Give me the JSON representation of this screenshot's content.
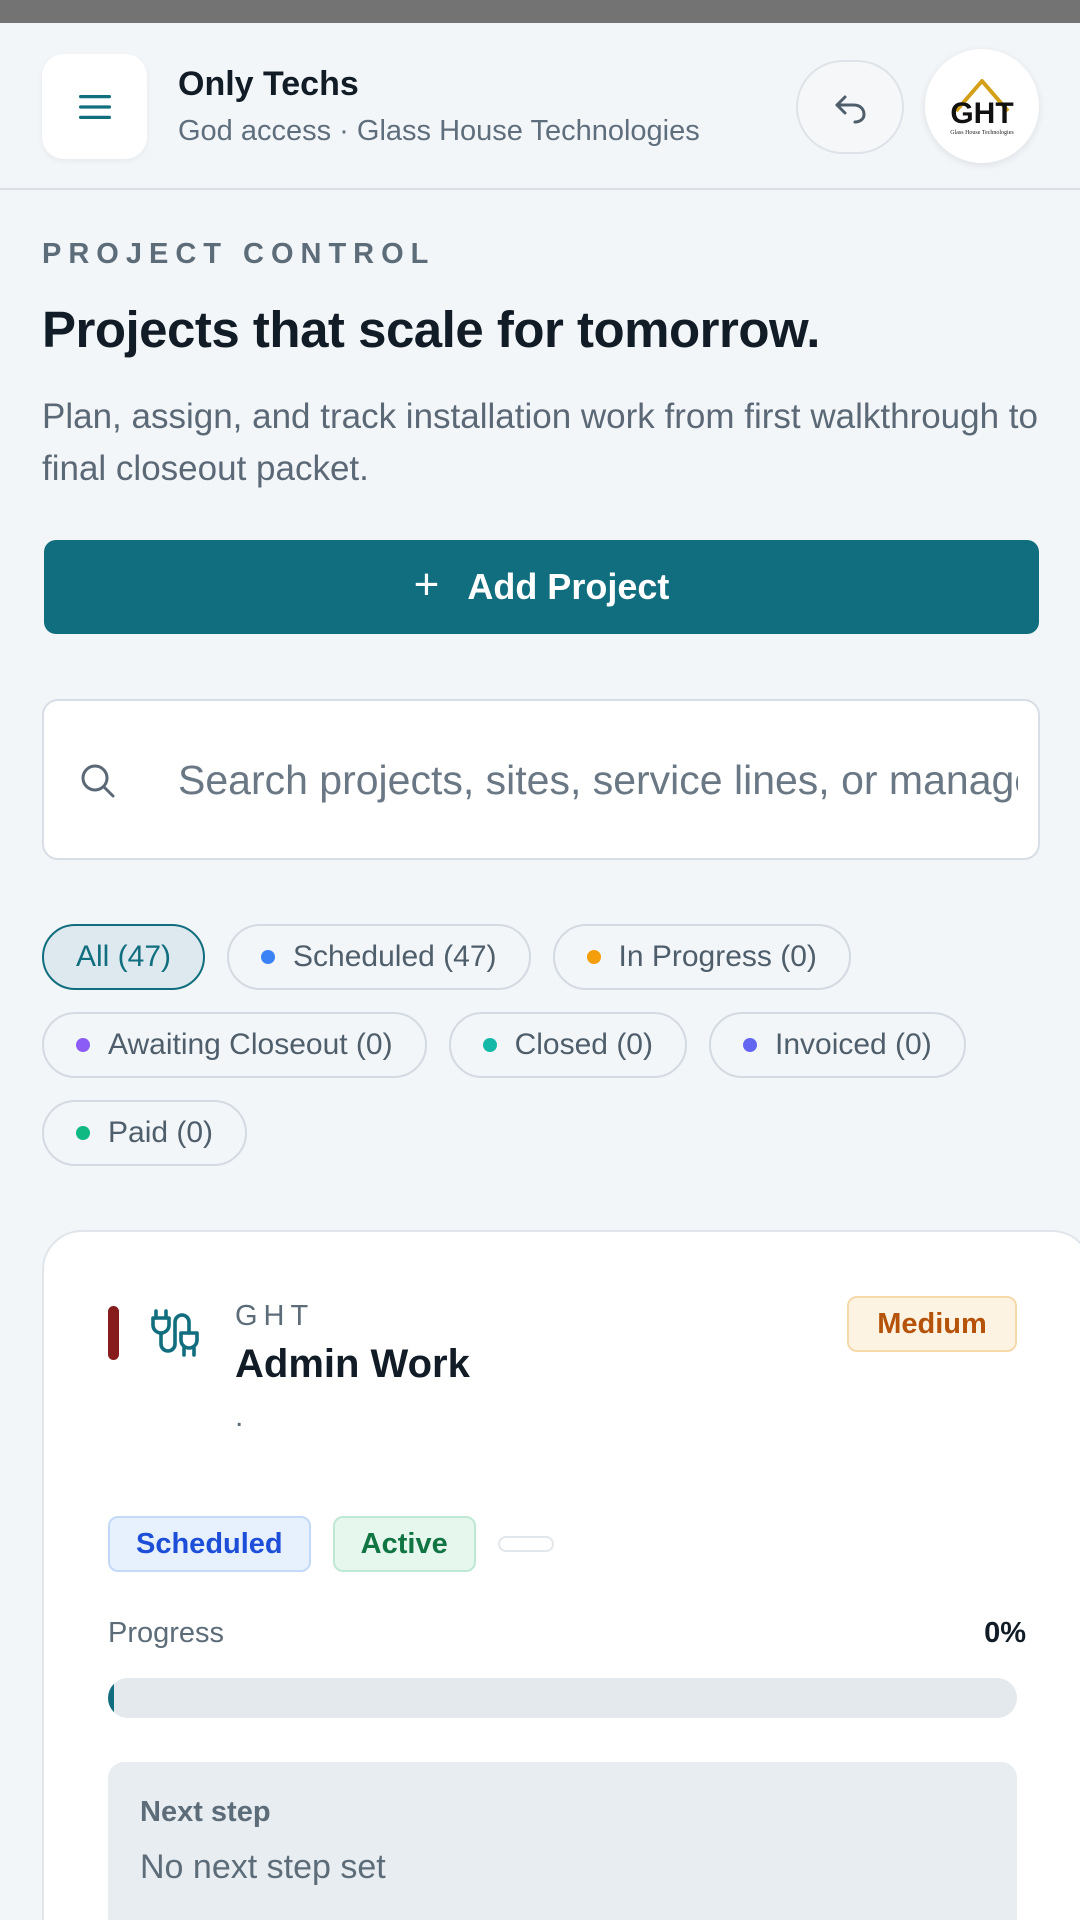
{
  "header": {
    "app_name": "Only Techs",
    "subtitle": "God access · Glass House Technologies",
    "logo_text": "GHT",
    "logo_tagline": "Glass House Technologies"
  },
  "hero": {
    "eyebrow": "PROJECT CONTROL",
    "title": "Projects that scale for tomorrow.",
    "description": "Plan, assign, and track installation work from first walkthrough to final closeout packet."
  },
  "add_button": {
    "icon": "plus-icon",
    "label": "Add Project"
  },
  "search": {
    "icon": "search-icon",
    "value": "",
    "placeholder": "Search projects, sites, service lines, or managers"
  },
  "filters": [
    {
      "label": "All (47)",
      "dot_color": null,
      "active": true
    },
    {
      "label": "Scheduled (47)",
      "dot_color": "#3b82f6",
      "active": false
    },
    {
      "label": "In Progress (0)",
      "dot_color": "#f59e0b",
      "active": false
    },
    {
      "label": "Awaiting Closeout (0)",
      "dot_color": "#8b5cf6",
      "active": false
    },
    {
      "label": "Closed (0)",
      "dot_color": "#14b8a6",
      "active": false
    },
    {
      "label": "Invoiced (0)",
      "dot_color": "#6366f1",
      "active": false
    },
    {
      "label": "Paid (0)",
      "dot_color": "#10b981",
      "active": false
    }
  ],
  "project_card": {
    "accent_color": "#861c1c",
    "type_icon": "plug-cable-icon",
    "client": "GHT",
    "name": "Admin Work",
    "site": ".",
    "priority": "Medium",
    "status_badge": "Scheduled",
    "state_badge": "Active",
    "progress_label": "Progress",
    "progress_value": "0%",
    "progress_fraction": 0,
    "next_step_label": "Next step",
    "next_step_value": "No next step set"
  },
  "colors": {
    "brand": "#116e7e",
    "background": "#f3f6f9",
    "priority_medium": "#b45309",
    "status_scheduled": "#1d4ed8",
    "state_active": "#107542"
  }
}
